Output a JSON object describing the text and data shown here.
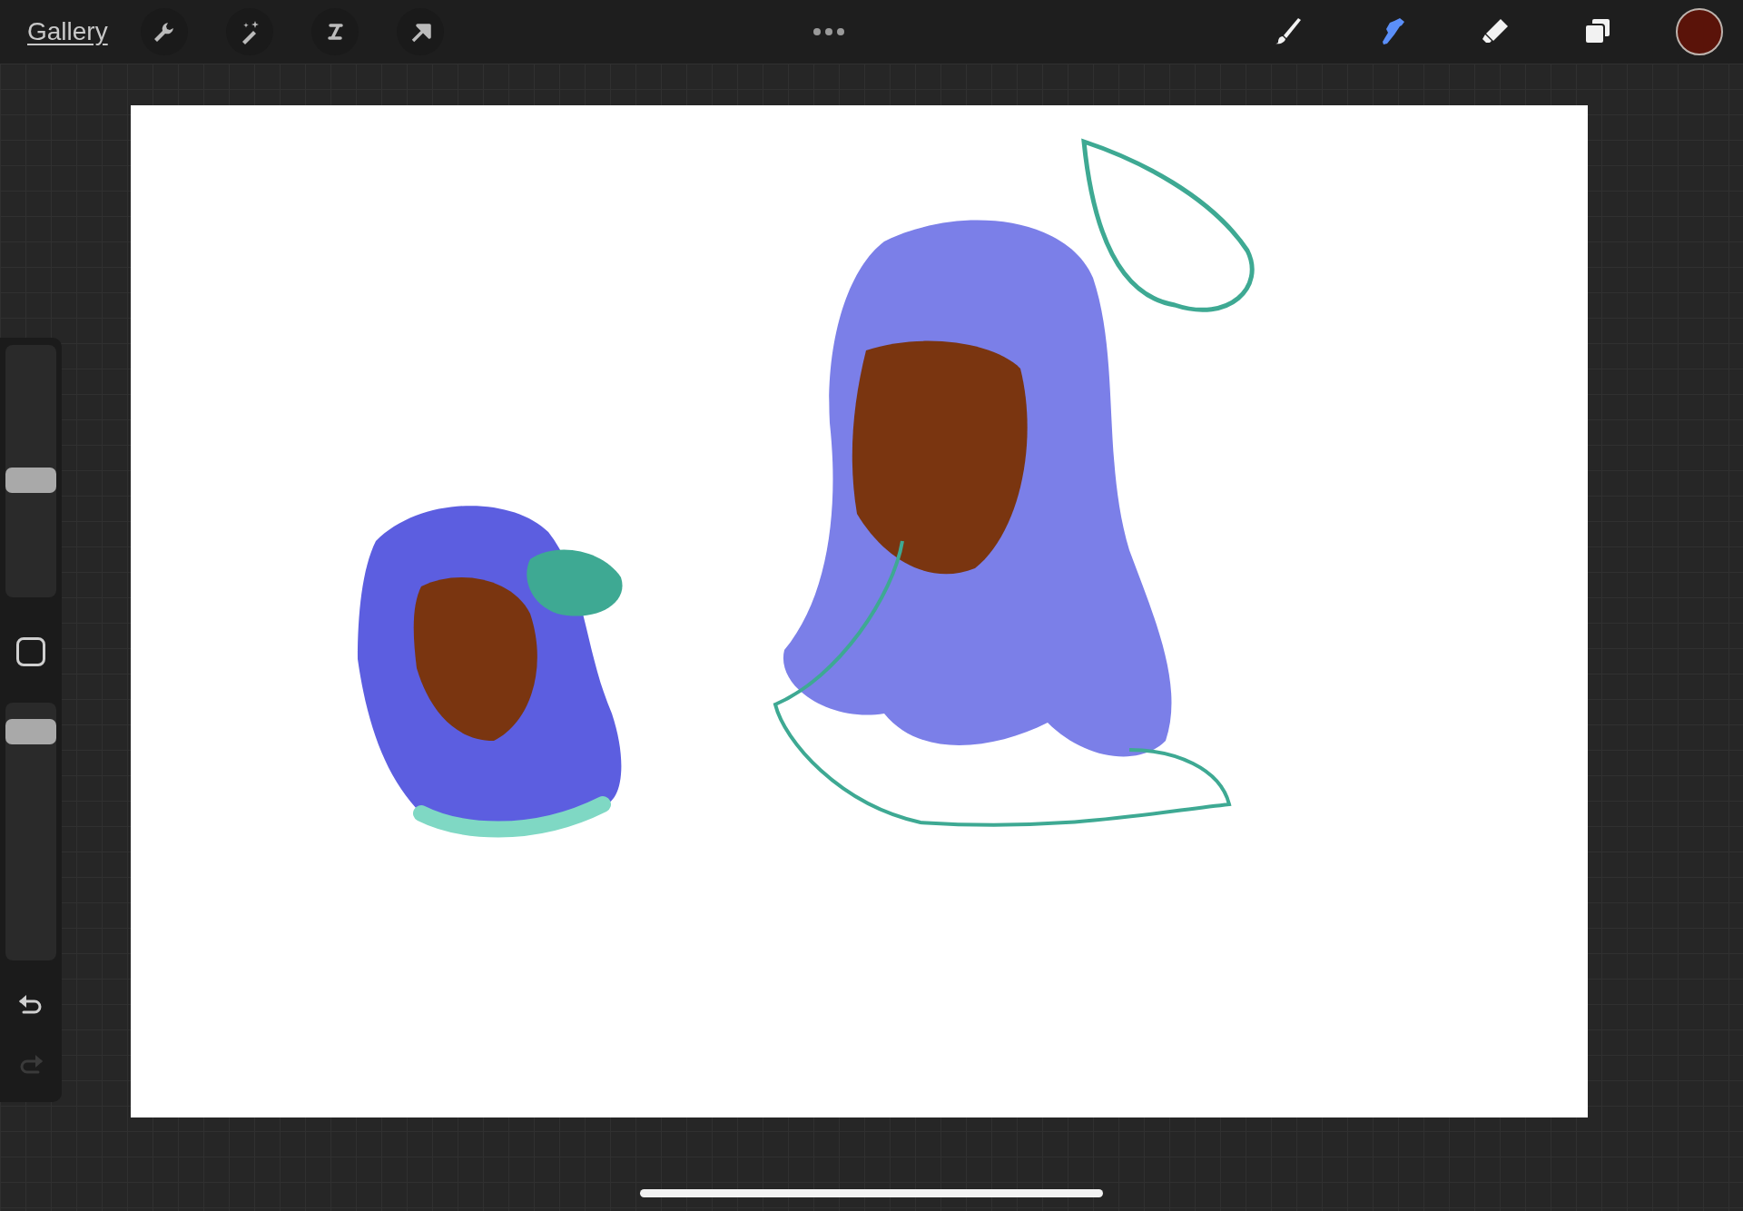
{
  "top_bar": {
    "gallery": "Gallery",
    "left_tools": [
      {
        "kind": "wrench",
        "selected": false
      },
      {
        "kind": "wand",
        "selected": false
      },
      {
        "kind": "selection",
        "selected": false
      },
      {
        "kind": "arrow",
        "selected": false
      }
    ],
    "right_tools": [
      {
        "kind": "brush",
        "selected": false
      },
      {
        "kind": "smudge",
        "selected": true
      },
      {
        "kind": "eraser",
        "selected": false
      },
      {
        "kind": "layers",
        "selected": false
      }
    ],
    "color_swatch": {
      "color": "#5a1309"
    }
  },
  "sidebar": {
    "size_slider": {
      "level": 0.46
    },
    "opacity_slider": {
      "level": 0.93
    },
    "undo": {
      "disabled": false
    },
    "redo": {
      "disabled": true
    }
  }
}
